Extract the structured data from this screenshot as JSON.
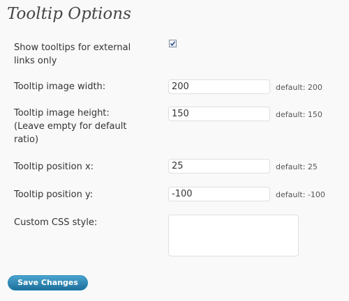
{
  "page_title": "Tooltip Options",
  "fields": {
    "external_only": {
      "label": "Show tooltips for external\nlinks only",
      "checked": true
    },
    "image_width": {
      "label": "Tooltip image width:",
      "value": "200",
      "default_note": "default: 200"
    },
    "image_height": {
      "label": "Tooltip image height:\n(Leave empty for default\nratio)",
      "value": "150",
      "default_note": "default: 150"
    },
    "position_x": {
      "label": "Tooltip position x:",
      "value": "25",
      "default_note": "default: 25"
    },
    "position_y": {
      "label": "Tooltip position y:",
      "value": "-100",
      "default_note": "default: -100"
    },
    "custom_css": {
      "label": "Custom CSS style:",
      "value": ""
    }
  },
  "save_button_label": "Save Changes",
  "colors": {
    "background": "#f9f9f9",
    "button_top": "#4aa3cf",
    "button_bottom": "#1e6f9b",
    "input_border": "#dfdfdf"
  }
}
